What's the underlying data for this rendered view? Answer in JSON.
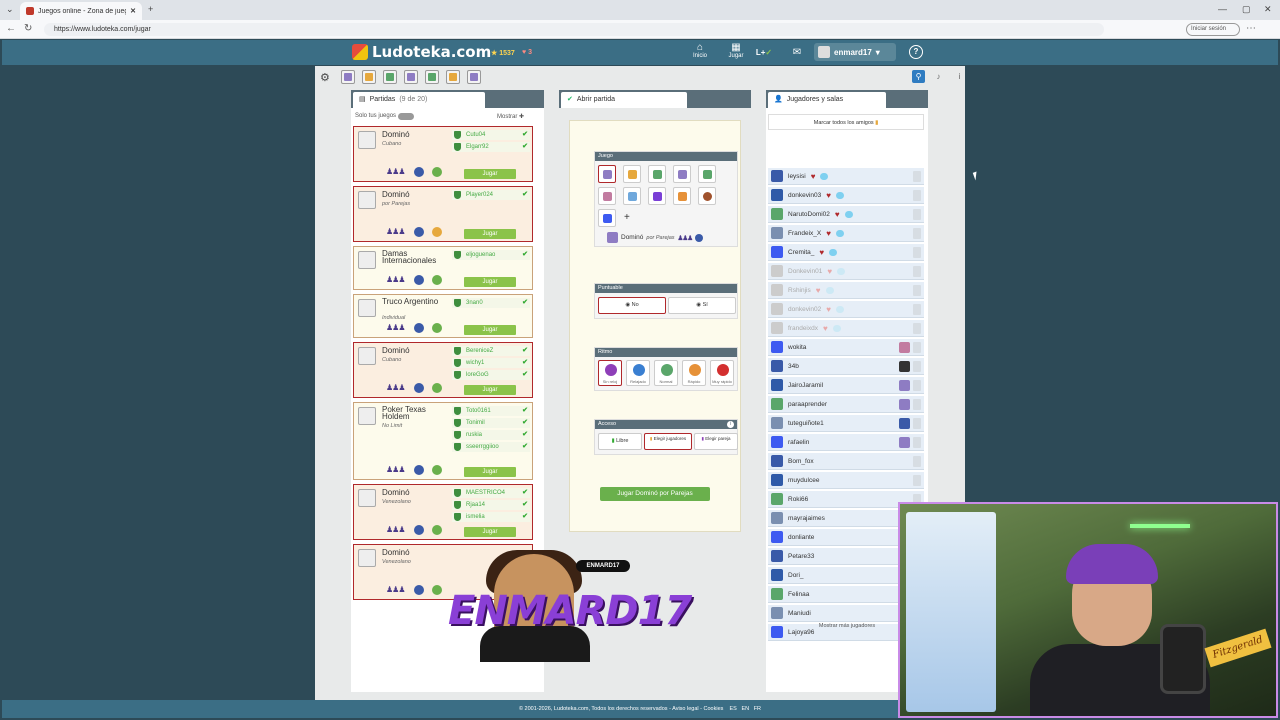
{
  "browser": {
    "tab_title": "Juegos online - Zona de juegos - ...",
    "url": "https://www.ludoteka.com/jugar",
    "signin": "Iniciar sesión"
  },
  "header": {
    "logo": "Ludoteka.com",
    "points": "1537",
    "hearts": "3",
    "nav_inicio": "Inicio",
    "nav_jugar": "Jugar",
    "nav_lplus": "L+",
    "username": "enmard17",
    "help": "?"
  },
  "partidas": {
    "title": "Partidas",
    "count": "(9 de 20)",
    "solo_label": "Solo tus juegos",
    "mostrar": "Mostrar",
    "cards": [
      {
        "name": "Dominó",
        "sub": "Cubano",
        "players": [
          "Cutu04",
          "Elgarr92"
        ],
        "btn": "Jugar",
        "hl": true
      },
      {
        "name": "Dominó",
        "sub": "por Parejas",
        "players": [
          "Player024"
        ],
        "btn": "Jugar",
        "hl": true
      },
      {
        "name": "Damas Internacionales",
        "sub": "",
        "players": [
          "eljoguenao"
        ],
        "btn": "Jugar",
        "hl": false
      },
      {
        "name": "Truco Argentino",
        "sub": "Individual",
        "players": [
          "3nan0"
        ],
        "btn": "Jugar",
        "hl": false
      },
      {
        "name": "Dominó",
        "sub": "Cubano",
        "players": [
          "BereniceZ",
          "wichy1",
          "loreGoG"
        ],
        "btn": "Jugar",
        "hl": true
      },
      {
        "name": "Poker Texas Holdem",
        "sub": "No Limit",
        "players": [
          "Toto0161",
          "Tonimil",
          "ruskia",
          "sseerrggiioo"
        ],
        "btn": "Jugar",
        "hl": false
      },
      {
        "name": "Dominó",
        "sub": "Venezolano",
        "players": [
          "MAESTRICO4",
          "Rjaa14",
          "ismelia"
        ],
        "btn": "Jugar",
        "hl": true
      },
      {
        "name": "Dominó",
        "sub": "Venezolano",
        "players": [],
        "btn": "",
        "hl": true
      }
    ]
  },
  "abrir": {
    "title": "Abrir partida",
    "juego_label": "Juego",
    "selected_game": "Dominó",
    "selected_sub": "por Parejas",
    "puntuable_label": "Puntuable",
    "puntuable_no": "No",
    "puntuable_si": "Sí",
    "ritmo_label": "Ritmo",
    "ritmo": [
      "Sin reloj",
      "Relajado",
      "Normal",
      "Rápido",
      "Muy rápido"
    ],
    "acceso_label": "Acceso",
    "acceso": [
      "Libre",
      "Elegir jugadores",
      "Elegir pareja"
    ],
    "play_button": "Jugar Dominó por Parejas"
  },
  "jugadores": {
    "title": "Jugadores y salas",
    "mark_all": "Marcar todos los amigos",
    "friends": [
      {
        "name": "leysisi",
        "heart": true,
        "msg": true,
        "off": false
      },
      {
        "name": "donkevin03",
        "heart": true,
        "msg": true,
        "off": false
      },
      {
        "name": "NarutoDomi02",
        "heart": true,
        "msg": true,
        "off": false
      },
      {
        "name": "Frandeix_X",
        "heart": true,
        "msg": true,
        "off": false
      },
      {
        "name": "Cremita_",
        "heart": true,
        "msg": true,
        "off": false
      },
      {
        "name": "Donkevin01",
        "heart": true,
        "msg": true,
        "off": true
      },
      {
        "name": "Rshinjis",
        "heart": true,
        "msg": true,
        "off": true
      },
      {
        "name": "donkevin02",
        "heart": true,
        "msg": true,
        "off": true
      },
      {
        "name": "frandeixdx",
        "heart": true,
        "msg": true,
        "off": true
      },
      {
        "name": "wokita",
        "heart": false,
        "msg": false,
        "off": false
      },
      {
        "name": "34b",
        "heart": false,
        "msg": false,
        "off": false
      },
      {
        "name": "JairoJaramil",
        "heart": false,
        "msg": false,
        "off": false
      },
      {
        "name": "paraaprender",
        "heart": false,
        "msg": false,
        "off": false
      },
      {
        "name": "tuteguiñote1",
        "heart": false,
        "msg": false,
        "off": false
      },
      {
        "name": "rafaelin",
        "heart": false,
        "msg": false,
        "off": false
      },
      {
        "name": "Bom_fox",
        "heart": false,
        "msg": false,
        "off": false
      },
      {
        "name": "muydulcee",
        "heart": false,
        "msg": false,
        "off": false
      },
      {
        "name": "Roki66",
        "heart": false,
        "msg": false,
        "off": false
      },
      {
        "name": "mayrajaimes",
        "heart": false,
        "msg": false,
        "off": false
      },
      {
        "name": "donliante",
        "heart": false,
        "msg": false,
        "off": false
      },
      {
        "name": "Petare33",
        "heart": false,
        "msg": false,
        "off": false
      },
      {
        "name": "Dori_",
        "heart": false,
        "msg": false,
        "off": false
      },
      {
        "name": "Felinaa",
        "heart": false,
        "msg": false,
        "off": false
      },
      {
        "name": "Maniudi",
        "heart": false,
        "msg": false,
        "off": false
      },
      {
        "name": "Lajoya96",
        "heart": false,
        "msg": false,
        "off": false
      }
    ],
    "more": "Mostrar más jugadores"
  },
  "footer": {
    "text": "© 2001-2026, Ludoteka.com, Todos los derechos reservados - Aviso legal - Cookies",
    "lang_es": "ES",
    "lang_en": "EN",
    "lang_fr": "FR"
  },
  "overlay": {
    "tag": "ENMARD17",
    "text": "ENMARD17"
  },
  "webcam": {
    "sticker": "Fitzgerald"
  }
}
